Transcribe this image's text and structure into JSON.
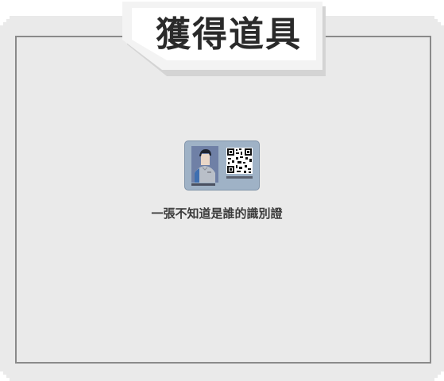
{
  "dialog": {
    "title": "獲得道具",
    "item": {
      "icon": "id-card-icon",
      "name": "一張不知道是誰的識別證"
    }
  }
}
